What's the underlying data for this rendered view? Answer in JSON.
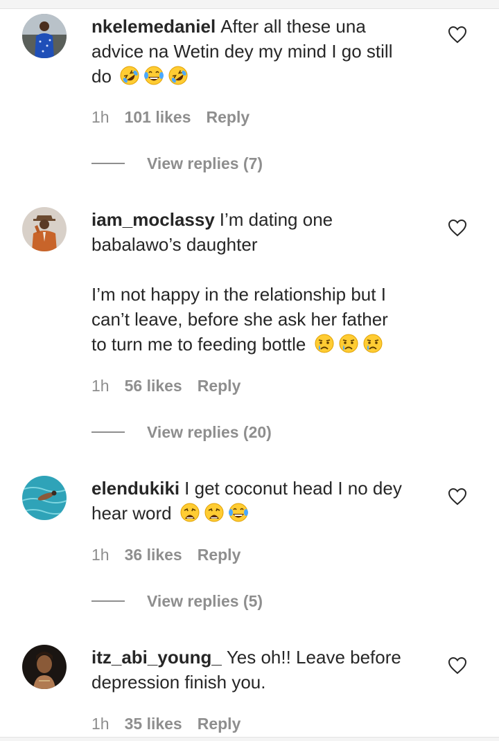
{
  "colors": {
    "text": "#262626",
    "muted": "#8e8e8e",
    "background": "#ffffff"
  },
  "comments": [
    {
      "username": "nkelemedaniel",
      "text_lines": [
        "After all these una",
        "advice na Wetin dey my mind I go still",
        "do"
      ],
      "emojis": [
        "rolling-on-floor-laughing",
        "face-with-tears-of-joy",
        "rolling-on-floor-laughing"
      ],
      "time": "1h",
      "likes": "101 likes",
      "reply_label": "Reply",
      "view_replies": "View replies (7)",
      "avatar": "man-in-blue-outfit"
    },
    {
      "username": "iam_moclassy",
      "text_lines": [
        "I’m dating one",
        "babalawo’s daughter",
        "",
        "I’m not happy in the relationship but I",
        "can’t leave, before she ask her father",
        "to turn me to feeding bottle"
      ],
      "emojis": [
        "crying-face",
        "crying-face",
        "crying-face"
      ],
      "time": "1h",
      "likes": "56 likes",
      "reply_label": "Reply",
      "view_replies": "View replies (20)",
      "avatar": "man-in-orange-suit-and-hat"
    },
    {
      "username": "elendukiki",
      "text_lines": [
        "I get coconut head I no dey",
        "hear word"
      ],
      "emojis": [
        "weary-face",
        "weary-face",
        "face-with-tears-of-joy"
      ],
      "time": "1h",
      "likes": "36 likes",
      "reply_label": "Reply",
      "view_replies": "View replies (5)",
      "avatar": "person-swimming-in-pool"
    },
    {
      "username": "itz_abi_young_",
      "text_lines": [
        "Yes oh!! Leave before",
        "depression finish you."
      ],
      "emojis": [],
      "time": "1h",
      "likes": "35 likes",
      "reply_label": "Reply",
      "view_replies": "",
      "avatar": "woman-portrait-dark"
    }
  ]
}
